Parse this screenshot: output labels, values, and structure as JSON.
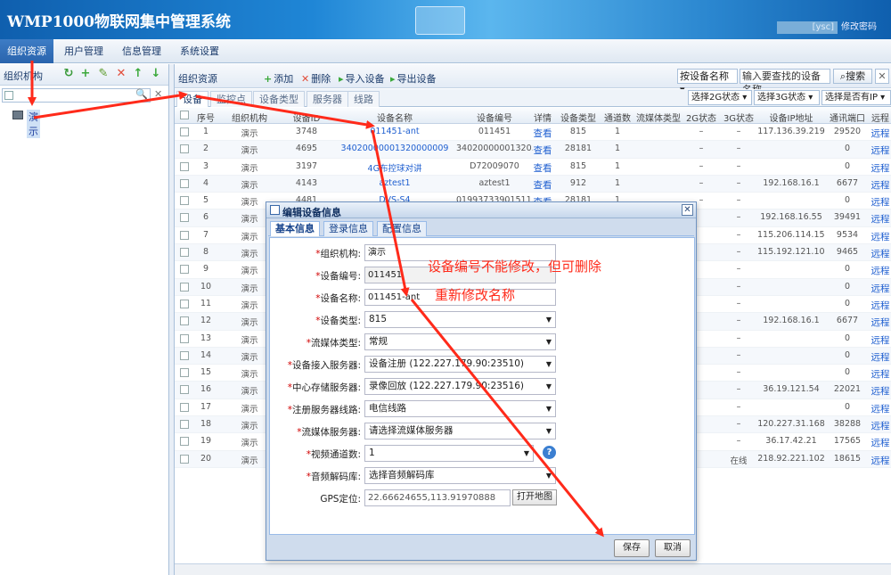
{
  "app": {
    "title": "WMP1000物联网集中管理系统",
    "user_label": "[ysc]",
    "change_password": "修改密码"
  },
  "nav": {
    "items": [
      "组织资源",
      "用户管理",
      "信息管理",
      "系统设置"
    ]
  },
  "left": {
    "title": "组织机构",
    "tree_item": "演示"
  },
  "right": {
    "title": "组织资源",
    "toolbar": {
      "add": "添加",
      "delete": "删除",
      "import": "导入设备",
      "export": "导出设备"
    },
    "search_by": "按设备名称",
    "search_placeholder": "输入要查找的设备名称",
    "search_button": "搜索",
    "tabs": [
      "设备",
      "监控点",
      "设备类型",
      "服务器",
      "线路"
    ],
    "filters": [
      "选择2G状态",
      "选择3G状态",
      "选择是否有IP"
    ]
  },
  "grid": {
    "columns": [
      "序号",
      "组织机构",
      "设备ID",
      "设备名称",
      "设备编号",
      "详情",
      "设备类型",
      "通道数",
      "流媒体类型",
      "2G状态",
      "3G状态",
      "设备IP地址",
      "通讯端口",
      "远程"
    ],
    "rows": [
      {
        "n": "1",
        "org": "演示",
        "id": "3748",
        "name": "011451-ant",
        "code": "011451",
        "detail": "查看",
        "type": "815",
        "ch": "1",
        "s2g": "–",
        "s3g": "–",
        "ip": "117.136.39.219",
        "port": "29520",
        "remote": "远程",
        "status": ""
      },
      {
        "n": "2",
        "org": "演示",
        "id": "4695",
        "name": "34020000001320000009",
        "code": "34020000001320…",
        "detail": "查看",
        "type": "28181",
        "ch": "1",
        "s2g": "–",
        "s3g": "–",
        "ip": "",
        "port": "0",
        "remote": "远程",
        "status": ""
      },
      {
        "n": "3",
        "org": "演示",
        "id": "3197",
        "name": "4G布控球对讲",
        "code": "D72009070",
        "detail": "查看",
        "type": "815",
        "ch": "1",
        "s2g": "–",
        "s3g": "–",
        "ip": "",
        "port": "0",
        "remote": "远程",
        "status": ""
      },
      {
        "n": "4",
        "org": "演示",
        "id": "4143",
        "name": "aztest1",
        "code": "aztest1",
        "detail": "查看",
        "type": "912",
        "ch": "1",
        "s2g": "–",
        "s3g": "–",
        "ip": "192.168.16.1",
        "port": "6677",
        "remote": "远程",
        "status": ""
      },
      {
        "n": "5",
        "org": "演示",
        "id": "4481",
        "name": "DVS-S4",
        "code": "01993733901511…",
        "detail": "查看",
        "type": "28181",
        "ch": "1",
        "s2g": "–",
        "s3g": "–",
        "ip": "",
        "port": "0",
        "remote": "远程",
        "status": ""
      },
      {
        "n": "6",
        "org": "演示",
        "id": "",
        "name": "",
        "code": "",
        "detail": "",
        "type": "",
        "ch": "",
        "s2g": "",
        "s3g": "–",
        "ip": "192.168.16.55",
        "port": "39491",
        "remote": "远程",
        "status": ""
      },
      {
        "n": "7",
        "org": "演示",
        "id": "",
        "name": "",
        "code": "",
        "detail": "",
        "type": "",
        "ch": "",
        "s2g": "",
        "s3g": "–",
        "ip": "115.206.114.151",
        "port": "9534",
        "remote": "远程",
        "status": ""
      },
      {
        "n": "8",
        "org": "演示",
        "id": "",
        "name": "",
        "code": "",
        "detail": "",
        "type": "",
        "ch": "",
        "s2g": "",
        "s3g": "–",
        "ip": "115.192.121.105",
        "port": "9465",
        "remote": "远程",
        "status": ""
      },
      {
        "n": "9",
        "org": "演示",
        "id": "",
        "name": "",
        "code": "",
        "detail": "",
        "type": "",
        "ch": "",
        "s2g": "",
        "s3g": "–",
        "ip": "",
        "port": "0",
        "remote": "远程",
        "status": ""
      },
      {
        "n": "10",
        "org": "演示",
        "id": "",
        "name": "",
        "code": "",
        "detail": "",
        "type": "",
        "ch": "",
        "s2g": "",
        "s3g": "–",
        "ip": "",
        "port": "0",
        "remote": "远程",
        "status": ""
      },
      {
        "n": "11",
        "org": "演示",
        "id": "",
        "name": "",
        "code": "",
        "detail": "",
        "type": "",
        "ch": "",
        "s2g": "",
        "s3g": "–",
        "ip": "",
        "port": "0",
        "remote": "远程",
        "status": ""
      },
      {
        "n": "12",
        "org": "演示",
        "id": "",
        "name": "",
        "code": "",
        "detail": "",
        "type": "",
        "ch": "",
        "s2g": "",
        "s3g": "–",
        "ip": "192.168.16.1",
        "port": "6677",
        "remote": "远程",
        "status": ""
      },
      {
        "n": "13",
        "org": "演示",
        "id": "",
        "name": "",
        "code": "",
        "detail": "",
        "type": "",
        "ch": "",
        "s2g": "",
        "s3g": "–",
        "ip": "",
        "port": "0",
        "remote": "远程",
        "status": ""
      },
      {
        "n": "14",
        "org": "演示",
        "id": "",
        "name": "",
        "code": "",
        "detail": "",
        "type": "",
        "ch": "",
        "s2g": "",
        "s3g": "–",
        "ip": "",
        "port": "0",
        "remote": "远程",
        "status": ""
      },
      {
        "n": "15",
        "org": "演示",
        "id": "",
        "name": "",
        "code": "",
        "detail": "",
        "type": "",
        "ch": "",
        "s2g": "",
        "s3g": "–",
        "ip": "",
        "port": "0",
        "remote": "远程",
        "status": ""
      },
      {
        "n": "16",
        "org": "演示",
        "id": "",
        "name": "",
        "code": "",
        "detail": "",
        "type": "",
        "ch": "",
        "s2g": "",
        "s3g": "–",
        "ip": "36.19.121.54",
        "port": "22021",
        "remote": "远程",
        "status": ""
      },
      {
        "n": "17",
        "org": "演示",
        "id": "",
        "name": "",
        "code": "",
        "detail": "",
        "type": "",
        "ch": "",
        "s2g": "",
        "s3g": "–",
        "ip": "",
        "port": "0",
        "remote": "远程",
        "status": ""
      },
      {
        "n": "18",
        "org": "演示",
        "id": "",
        "name": "",
        "code": "",
        "detail": "",
        "type": "",
        "ch": "",
        "s2g": "",
        "s3g": "–",
        "ip": "120.227.31.168",
        "port": "38288",
        "remote": "远程",
        "status": ""
      },
      {
        "n": "19",
        "org": "演示",
        "id": "",
        "name": "",
        "code": "",
        "detail": "",
        "type": "",
        "ch": "",
        "s2g": "",
        "s3g": "–",
        "ip": "36.17.42.21",
        "port": "17565",
        "remote": "远程",
        "status": ""
      },
      {
        "n": "20",
        "org": "演示",
        "id": "",
        "name": "",
        "code": "",
        "detail": "",
        "type": "",
        "ch": "",
        "s2g": "",
        "s3g": "在线",
        "ip": "218.92.221.102",
        "port": "18615",
        "remote": "远程",
        "status": ""
      }
    ]
  },
  "dialog": {
    "title": "编辑设备信息",
    "tabs": [
      "基本信息",
      "登录信息",
      "配置信息"
    ],
    "fields": {
      "org": {
        "label": "组织机构:",
        "value": "演示"
      },
      "code": {
        "label": "设备编号:",
        "value": "011451"
      },
      "name": {
        "label": "设备名称:",
        "value": "011451-ant"
      },
      "type": {
        "label": "设备类型:",
        "value": "815"
      },
      "stream_type": {
        "label": "流媒体类型:",
        "value": "常规"
      },
      "access_server": {
        "label": "设备接入服务器:",
        "value": "设备注册 (122.227.179.90:23510)"
      },
      "storage_server": {
        "label": "中心存储服务器:",
        "value": "录像回放 (122.227.179.90:23516)"
      },
      "reg_line": {
        "label": "注册服务器线路:",
        "value": "电信线路"
      },
      "stream_server": {
        "label": "流媒体服务器:",
        "value": "请选择流媒体服务器"
      },
      "channels": {
        "label": "视频通道数:",
        "value": "1"
      },
      "audio_codec": {
        "label": "音频解码库:",
        "value": "选择音频解码库"
      },
      "gps": {
        "label": "GPS定位:",
        "value": "22.66624655,113.91970888"
      }
    },
    "map_button": "打开地图",
    "ok": "保存",
    "cancel": "取消"
  },
  "annotations": {
    "note1": "设备编号不能修改，但可删除",
    "note2": "重新修改名称",
    "color": "#ff2a1a"
  }
}
